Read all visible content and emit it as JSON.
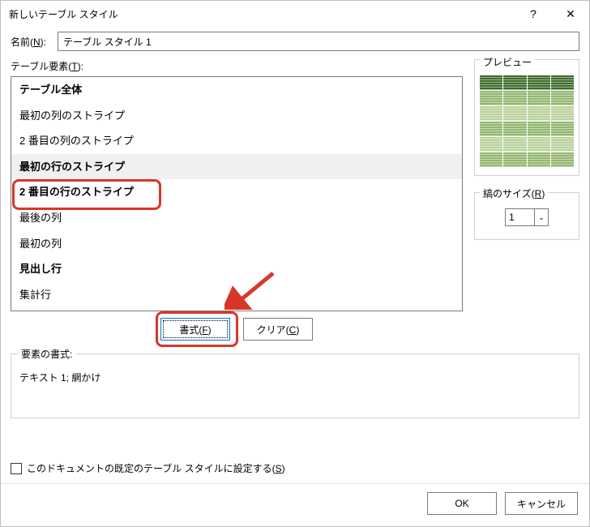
{
  "titlebar": {
    "title": "新しいテーブル スタイル",
    "help": "?",
    "close": "✕"
  },
  "name": {
    "label_pre": "名前(",
    "label_hot": "N",
    "label_post": "):",
    "value": "テーブル スタイル 1"
  },
  "elements": {
    "label_pre": "テーブル要素(",
    "label_hot": "T",
    "label_post": "):",
    "items": [
      {
        "text": "テーブル全体",
        "bold": true
      },
      {
        "text": "最初の列のストライプ",
        "bold": false
      },
      {
        "text": "2 番目の列のストライプ",
        "bold": false
      },
      {
        "text": "最初の行のストライプ",
        "bold": true,
        "selected": true
      },
      {
        "text": "2 番目の行のストライプ",
        "bold": true
      },
      {
        "text": "最後の列",
        "bold": false
      },
      {
        "text": "最初の列",
        "bold": false
      },
      {
        "text": "見出し行",
        "bold": true
      },
      {
        "text": "集計行",
        "bold": false
      }
    ]
  },
  "buttons": {
    "format_pre": "書式(",
    "format_hot": "F",
    "format_post": ")",
    "clear_pre": "クリア(",
    "clear_hot": "C",
    "clear_post": ")"
  },
  "preview": {
    "title": "プレビュー"
  },
  "stripe": {
    "label_pre": "縞のサイズ(",
    "label_hot": "R",
    "label_post": ")",
    "value": "1",
    "spin": "⌄"
  },
  "element_format": {
    "title": "要素の書式:",
    "text": "テキスト 1; 網かけ"
  },
  "default_check": {
    "label_pre": "このドキュメントの既定のテーブル スタイルに設定する(",
    "label_hot": "S",
    "label_post": ")"
  },
  "footer": {
    "ok": "OK",
    "cancel": "キャンセル"
  },
  "annotations": {
    "highlight_index": 4
  }
}
